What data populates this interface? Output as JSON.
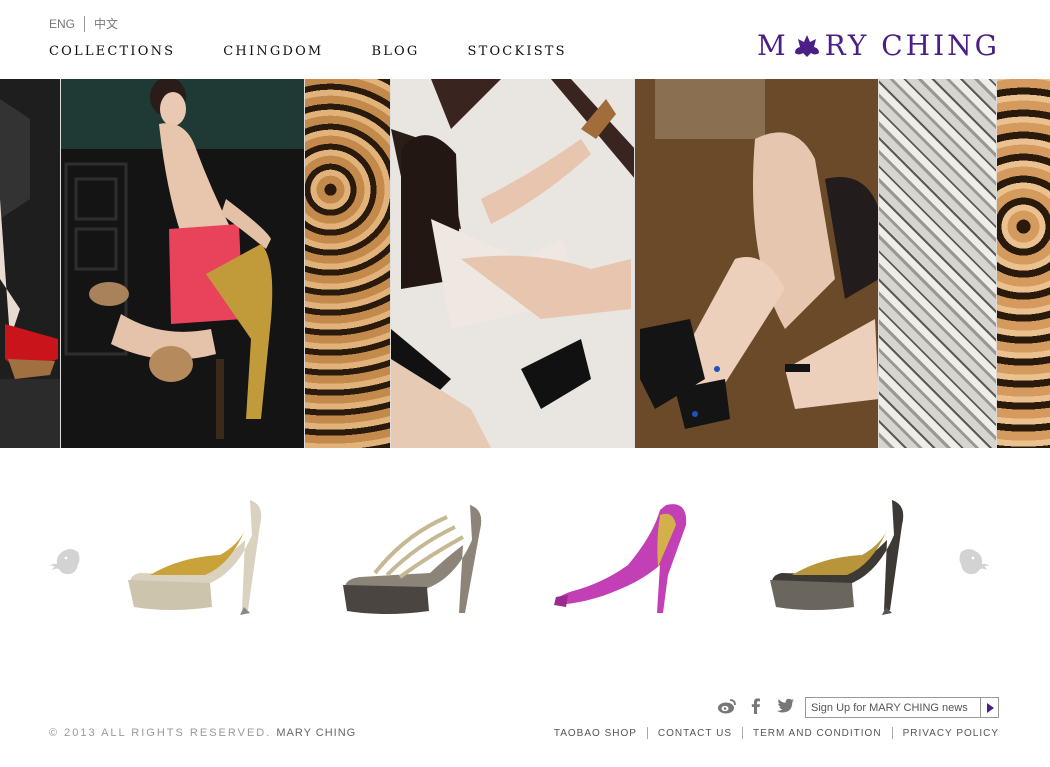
{
  "header": {
    "languages": [
      "ENG",
      "中文"
    ],
    "nav": [
      "COLLECTIONS",
      "CHINGDOM",
      "BLOG",
      "STOCKISTS"
    ],
    "logo_left": "M",
    "logo_right": "RY CHING",
    "brand_color": "#4b1f86"
  },
  "carousel": {
    "prev_icon": "elephant-left-icon",
    "next_icon": "elephant-right-icon",
    "shoes": [
      {
        "name": "gold-platform-pump",
        "color": "#d8d2bf"
      },
      {
        "name": "bronze-strappy-platform",
        "color": "#8c8479"
      },
      {
        "name": "magenta-peeptoe-pump",
        "color": "#c23fb5"
      },
      {
        "name": "black-lace-platform-pump",
        "color": "#3d3a35"
      }
    ]
  },
  "footer": {
    "social": [
      "weibo-icon",
      "facebook-icon",
      "twitter-icon"
    ],
    "newsletter_placeholder": "Sign Up for MARY CHING news",
    "copyright": "© 2013 ALL RIGHTS RESERVED.",
    "copyright_brand": "MARY CHING",
    "links": [
      "TAOBAO SHOP",
      "CONTACT US",
      "TERM AND CONDITION",
      "PRIVACY POLICY"
    ]
  }
}
